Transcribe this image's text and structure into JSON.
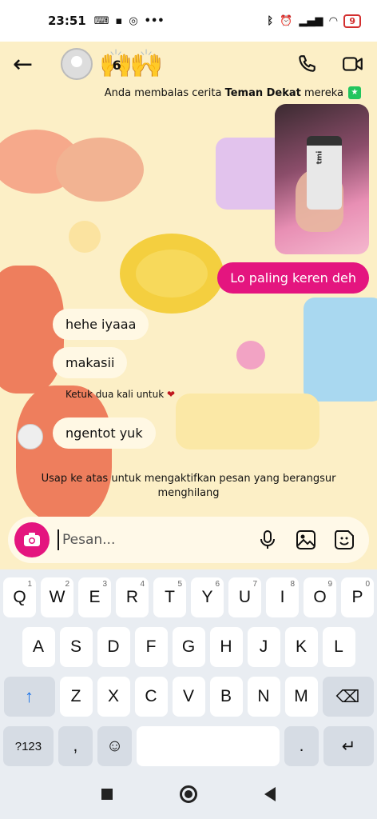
{
  "status_bar": {
    "time": "23:51",
    "battery": "9"
  },
  "header": {
    "name_suffix": "6",
    "hands_emoji": "🙌🙌"
  },
  "reply_note": {
    "prefix": "Anda membalas cerita ",
    "bold": "Teman Dekat",
    "suffix": " mereka"
  },
  "story": {
    "device_label": "tmi"
  },
  "messages": [
    {
      "from": "me",
      "text": "Lo paling keren deh"
    },
    {
      "from": "them",
      "text": "hehe iyaaa"
    },
    {
      "from": "them",
      "text": "makasii"
    },
    {
      "from": "them",
      "text": "ngentot yuk"
    }
  ],
  "double_tap_hint": "Ketuk dua kali untuk",
  "swipe_note": "Usap ke atas untuk mengaktifkan pesan yang berangsur menghilang",
  "composer": {
    "placeholder": "Pesan..."
  },
  "keyboard": {
    "row1": [
      [
        "Q",
        "1"
      ],
      [
        "W",
        "2"
      ],
      [
        "E",
        "3"
      ],
      [
        "R",
        "4"
      ],
      [
        "T",
        "5"
      ],
      [
        "Y",
        "6"
      ],
      [
        "U",
        "7"
      ],
      [
        "I",
        "8"
      ],
      [
        "O",
        "9"
      ],
      [
        "P",
        "0"
      ]
    ],
    "row2": [
      "A",
      "S",
      "D",
      "F",
      "G",
      "H",
      "J",
      "K",
      "L"
    ],
    "row3": [
      "Z",
      "X",
      "C",
      "V",
      "B",
      "N",
      "M"
    ],
    "sym_label": "?123",
    "comma": ",",
    "dot": "."
  },
  "colors": {
    "accent": "#e4157f",
    "chat_bg": "#fcefc6"
  }
}
